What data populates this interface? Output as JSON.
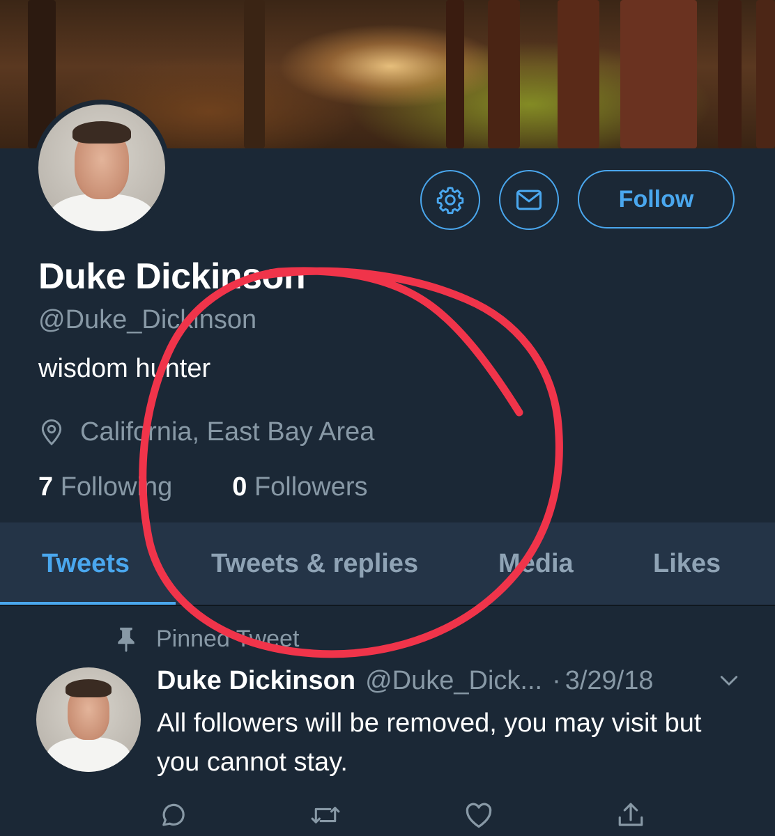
{
  "profile": {
    "name": "Duke Dickinson",
    "handle": "@Duke_Dickinson",
    "bio": "wisdom hunter",
    "location": "California, East Bay Area",
    "following_count": "7",
    "following_label": "Following",
    "followers_count": "0",
    "followers_label": "Followers"
  },
  "actions": {
    "follow_label": "Follow",
    "settings_icon": "gear-icon",
    "message_icon": "envelope-icon"
  },
  "tabs": [
    {
      "label": "Tweets",
      "active": true
    },
    {
      "label": "Tweets & replies",
      "active": false
    },
    {
      "label": "Media",
      "active": false
    },
    {
      "label": "Likes",
      "active": false
    }
  ],
  "pinned_tweet": {
    "pinned_label": "Pinned Tweet",
    "author_name": "Duke Dickinson",
    "author_handle": "@Duke_Dick...",
    "separator": "·",
    "date": "3/29/18",
    "text": "All followers will be removed, you may visit but you cannot stay."
  },
  "colors": {
    "background": "#1b2836",
    "tab_bar": "#243447",
    "accent": "#4aa7ee",
    "secondary_text": "#8899a6",
    "annotation": "#f0344a"
  }
}
